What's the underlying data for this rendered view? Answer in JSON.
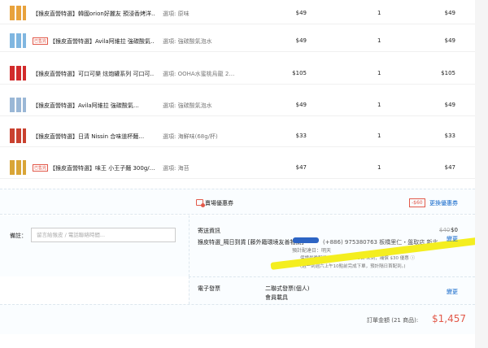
{
  "items": [
    {
      "tag": "",
      "name": "【猴皮直營特選】韓國orion好麗友 預浸香烤洋…",
      "variation": "選項: 原味",
      "price": "$49",
      "qty": "1",
      "subtotal": "$49",
      "thumb_color": "#e8a23c"
    },
    {
      "tag": "已售完",
      "name": "【猴皮直營特選】Avila阿維拉 強碳酸氣…",
      "variation": "選項: 強碳酸氣泡水",
      "price": "$49",
      "qty": "1",
      "subtotal": "$49",
      "thumb_color": "#7fb6e0"
    },
    {
      "tag": "",
      "name": "【猴皮直營特選】可口可樂 炫炮罐系列 可口可…",
      "variation": "選項: OOHA水蜜桃烏龍 2…",
      "price": "$105",
      "qty": "1",
      "subtotal": "$105",
      "thumb_color": "#d22b2b"
    },
    {
      "tag": "",
      "name": "【猴皮直營特選】Avila阿維拉 強碳酸氣…",
      "variation": "選項: 強碳酸氣泡水",
      "price": "$49",
      "qty": "1",
      "subtotal": "$49",
      "thumb_color": "#9ab7d6"
    },
    {
      "tag": "",
      "name": "【猴皮直營特選】日清 Nissin 合味道杯麵…",
      "variation": "選項: 海鮮味(68g/杯)",
      "price": "$33",
      "qty": "1",
      "subtotal": "$33",
      "thumb_color": "#c9412f"
    },
    {
      "tag": "已售完",
      "name": "【猴皮直營特選】味王 小王子麵 300g/…",
      "variation": "選項: 海苔",
      "price": "$47",
      "qty": "1",
      "subtotal": "$47",
      "thumb_color": "#d9a537"
    }
  ],
  "coupon": {
    "label": "賣場優惠券",
    "badge": "-$60",
    "link": "更換優惠券"
  },
  "memo": {
    "label": "備註：",
    "placeholder": "留言給猴皮 / 電話聯絡時間..."
  },
  "shipping": {
    "title": "寄送資訊",
    "method": "猴皮特選_隔日到貨 [藤外籍環境友善物流]",
    "phone": "(+886) 975380763   板橋里仁・盤取店    新北…",
    "eta": "預計配達日：明天",
    "promo": "保證最晚配達：2025年5月13日 未到，補償 $30 優惠 ⓘ",
    "note": "(週一到週六上午10點前完成下單，預計隔日首配到。)",
    "original_fee": "$40",
    "fee": "$0",
    "change": "變更"
  },
  "invoice": {
    "label": "電子發票",
    "type": "二聯式發票(個人)",
    "sub": "會員載具",
    "change": "變更"
  },
  "total": {
    "label": "訂單金額 (21 商品):",
    "value": "$1,457"
  }
}
